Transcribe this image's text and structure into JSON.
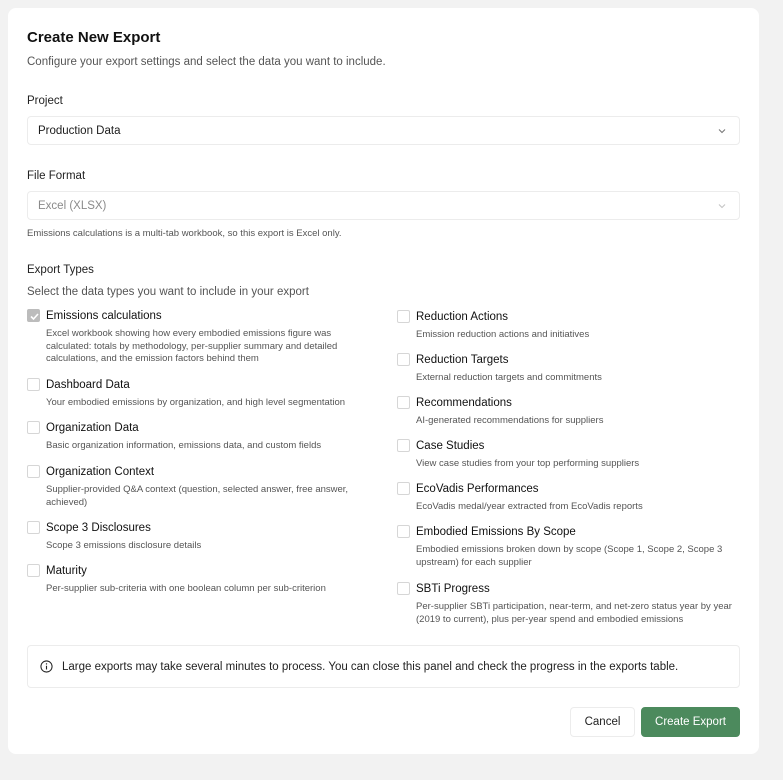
{
  "dialog": {
    "title": "Create New Export",
    "subtitle": "Configure your export settings and select the data you want to include."
  },
  "project": {
    "label": "Project",
    "value": "Production Data",
    "icon": "chevron-down-icon"
  },
  "file_format": {
    "label": "File Format",
    "value": "Excel (XLSX)",
    "disabled": true,
    "helper": "Emissions calculations is a multi-tab workbook, so this export is Excel only."
  },
  "export_types": {
    "label": "Export Types",
    "subtitle": "Select the data types you want to include in your export",
    "left": [
      {
        "title": "Emissions calculations",
        "desc": "Excel workbook showing how every embodied emissions figure was calculated: totals by methodology, per-supplier summary and detailed calculations, and the emission factors behind them",
        "checked": true
      },
      {
        "title": "Dashboard Data",
        "desc": "Your embodied emissions by organization, and high level segmentation",
        "checked": false
      },
      {
        "title": "Organization Data",
        "desc": "Basic organization information, emissions data, and custom fields",
        "checked": false
      },
      {
        "title": "Organization Context",
        "desc": "Supplier-provided Q&A context (question, selected answer, free answer, achieved)",
        "checked": false
      },
      {
        "title": "Scope 3 Disclosures",
        "desc": "Scope 3 emissions disclosure details",
        "checked": false
      },
      {
        "title": "Maturity",
        "desc": "Per-supplier sub-criteria with one boolean column per sub-criterion",
        "checked": false
      }
    ],
    "right": [
      {
        "title": "Reduction Actions",
        "desc": "Emission reduction actions and initiatives",
        "checked": false
      },
      {
        "title": "Reduction Targets",
        "desc": "External reduction targets and commitments",
        "checked": false
      },
      {
        "title": "Recommendations",
        "desc": "AI-generated recommendations for suppliers",
        "checked": false
      },
      {
        "title": "Case Studies",
        "desc": "View case studies from your top performing suppliers",
        "checked": false
      },
      {
        "title": "EcoVadis Performances",
        "desc": "EcoVadis medal/year extracted from EcoVadis reports",
        "checked": false
      },
      {
        "title": "Embodied Emissions By Scope",
        "desc": "Embodied emissions broken down by scope (Scope 1, Scope 2, Scope 3 upstream) for each supplier",
        "checked": false
      },
      {
        "title": "SBTi Progress",
        "desc": "Per-supplier SBTi participation, near-term, and net-zero status year by year (2019 to current), plus per-year spend and embodied emissions",
        "checked": false
      }
    ]
  },
  "info": {
    "icon": "info-icon",
    "text": "Large exports may take several minutes to process. You can close this panel and check the progress in the exports table."
  },
  "actions": {
    "cancel_label": "Cancel",
    "create_label": "Create Export"
  },
  "colors": {
    "primary": "#4c8a5d",
    "checkbox_checked": "#bcbcbc"
  }
}
